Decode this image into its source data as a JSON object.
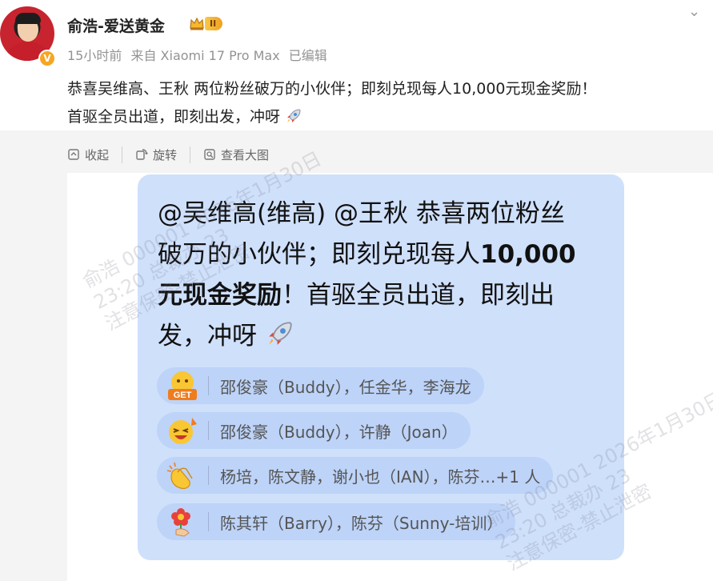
{
  "post": {
    "username": "俞浩-爱送黄金",
    "level_badge": "II",
    "time": "15小时前",
    "source": "来自 Xiaomi 17 Pro Max",
    "edited": "已编辑",
    "text_line1": "恭喜吴维高、王秋 两位粉丝破万的小伙伴；即刻兑现每人10,000元现金奖励！",
    "text_line2": "首驱全员出道，即刻出发，冲呀"
  },
  "toolbar": {
    "collapse": "收起",
    "rotate": "旋转",
    "view_large": "查看大图"
  },
  "card": {
    "line1": "@吴维高(维高) @王秋 恭喜两位粉丝",
    "line2a": "破万的小伙伴；即刻兑现每人",
    "line2b": "10,000",
    "line3a": "元现金奖励",
    "line3b": "！首驱全员出道，即刻出",
    "line4": "发，冲呀"
  },
  "reactions": [
    {
      "icon": "get-emoji-icon",
      "names": "邵俊豪（Buddy），任金华，李海龙"
    },
    {
      "icon": "laughing-emoji-icon",
      "names": "邵俊豪（Buddy），许静（Joan）"
    },
    {
      "icon": "clapping-hands-icon",
      "names": "杨培，陈文静，谢小也（IAN），陈芬…+1 人"
    },
    {
      "icon": "flower-emoji-icon",
      "names": "陈其轩（Barry），陈芬（Sunny-培训）"
    }
  ],
  "watermarks": [
    "俞浩 000001 2026年1月30日",
    "23:20 总裁办 23",
    "注意保密-禁止泄密"
  ],
  "colors": {
    "card_bg": "#cfe0fb",
    "pill_bg": "#bdd3f8",
    "badge_gold": "#f5a623"
  }
}
